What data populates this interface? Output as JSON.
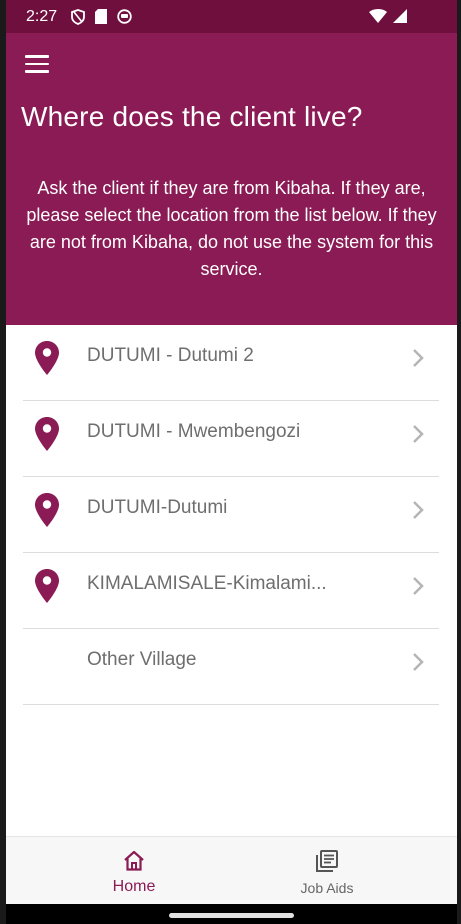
{
  "status_bar": {
    "time": "2:27",
    "icons": [
      "shield-icon",
      "sd-card-icon",
      "face-icon",
      "wifi-icon",
      "signal-icon"
    ]
  },
  "header": {
    "title": "Where does the client live?",
    "description": "Ask the client if they are from Kibaha. If they are, please select the location from the list below. If they are not from Kibaha, do not use the system for this service."
  },
  "locations": [
    {
      "label": "DUTUMI - Dutumi 2",
      "icon": "location-pin-icon"
    },
    {
      "label": "DUTUMI - Mwembengozi",
      "icon": "location-pin-icon"
    },
    {
      "label": "DUTUMI-Dutumi",
      "icon": "location-pin-icon"
    },
    {
      "label": "KIMALAMISALE-Kimalami...",
      "icon": "location-pin-icon"
    },
    {
      "label": "Other Village",
      "icon": null
    }
  ],
  "bottom_nav": {
    "home": {
      "label": "Home",
      "active": true
    },
    "job_aids": {
      "label": "Job Aids",
      "active": false
    }
  },
  "colors": {
    "primary": "#8a1b54",
    "status_bar": "#6f0f3e",
    "text_muted": "#6e6e6e"
  }
}
